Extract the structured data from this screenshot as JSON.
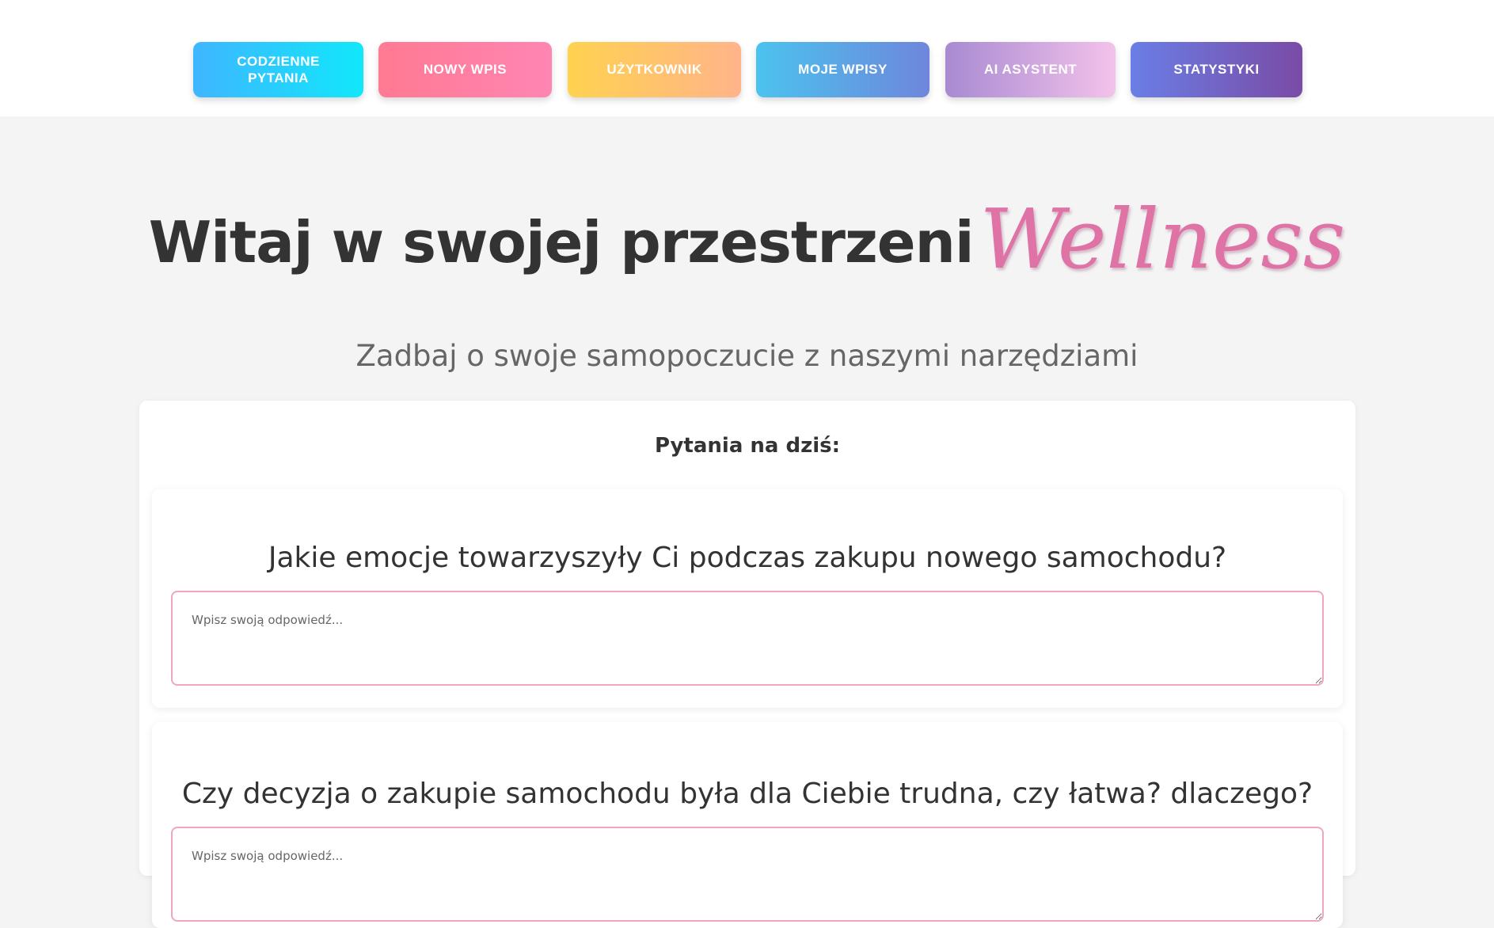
{
  "nav": {
    "items": [
      {
        "label": "CODZIENNE PYTANIA"
      },
      {
        "label": "NOWY WPIS"
      },
      {
        "label": "UŻYTKOWNIK"
      },
      {
        "label": "MOJE WPISY"
      },
      {
        "label": "AI ASYSTENT"
      },
      {
        "label": "STATYSTYKI"
      }
    ]
  },
  "hero": {
    "title": "Witaj w swojej przestrzeni",
    "accent": "Wellness",
    "subtitle": "Zadbaj o swoje samopoczucie z naszymi narzędziami"
  },
  "questions_panel": {
    "heading": "Pytania na dziś:",
    "questions": [
      {
        "text": "Jakie emocje towarzyszyły Ci podczas zakupu nowego samochodu?",
        "answer": "",
        "placeholder": "Wpisz swoją odpowiedź..."
      },
      {
        "text": "Czy decyzja o zakupie samochodu była dla Ciebie trudna, czy łatwa? dlaczego?",
        "answer": "",
        "placeholder": "Wpisz swoją odpowiedź..."
      }
    ]
  },
  "colors": {
    "accent_pink": "#df73a5",
    "input_border": "#f1a7b9",
    "page_background": "#f4f4f4"
  }
}
